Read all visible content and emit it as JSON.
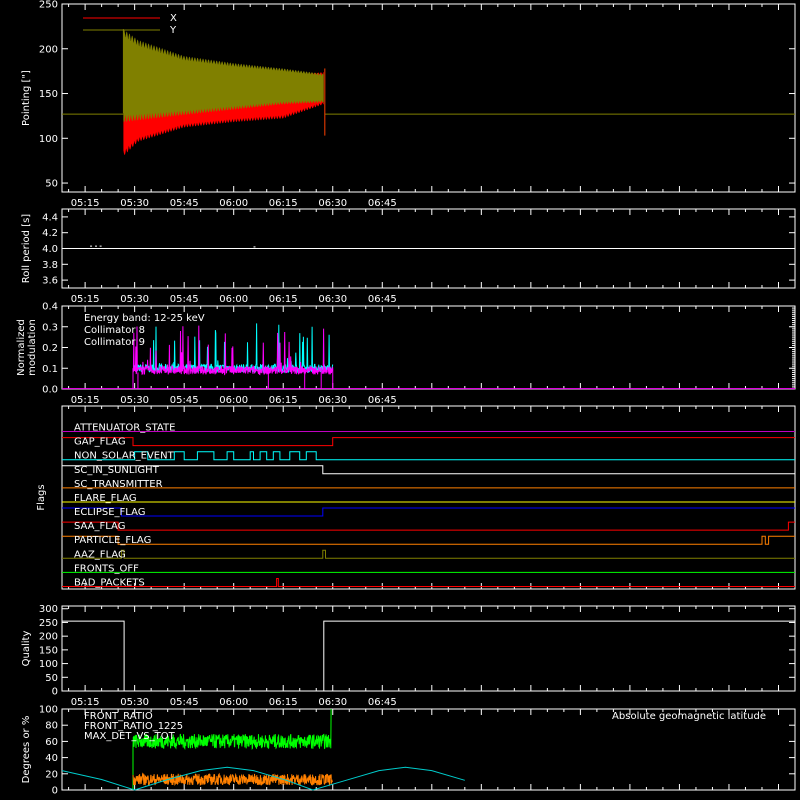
{
  "figure": {
    "background": "#000000",
    "foreground": "#ffffff",
    "time_ticks": [
      "05:15",
      "05:30",
      "05:45",
      "06:00",
      "06:15",
      "06:30",
      "06:45"
    ],
    "time_range_minutes": [
      308,
      530
    ],
    "x_tick_minutes": [
      315,
      330,
      345,
      360,
      375,
      390,
      405
    ]
  },
  "chart_data": [
    {
      "panel": "pointing",
      "type": "line",
      "ylabel": "Pointing [\"]",
      "ylim": [
        40,
        250
      ],
      "yticks": [
        50,
        100,
        150,
        200,
        250
      ],
      "legend_position": "top-left",
      "series": [
        {
          "name": "X",
          "color": "#ff0000",
          "baseline": 127,
          "envelope_start_min": 326.6,
          "envelope_end_min": 387.6,
          "envelope_upper": [
            [
              326.6,
              160
            ],
            [
              331,
              156
            ],
            [
              345,
              163
            ],
            [
              360,
              167
            ],
            [
              375,
              170
            ],
            [
              387.3,
              174
            ]
          ],
          "envelope_lower": [
            [
              326.6,
              80
            ],
            [
              331,
              96
            ],
            [
              345,
              112
            ],
            [
              360,
              118
            ],
            [
              375,
              122
            ],
            [
              387.3,
              138
            ]
          ]
        },
        {
          "name": "Y",
          "color": "#808000",
          "baseline": 127,
          "envelope_start_min": 326.6,
          "envelope_end_min": 387.6,
          "envelope_upper": [
            [
              326.6,
              222
            ],
            [
              331,
              210
            ],
            [
              345,
              192
            ],
            [
              360,
              184
            ],
            [
              375,
              178
            ],
            [
              387.3,
              172
            ]
          ],
          "envelope_lower": [
            [
              326.6,
              118
            ],
            [
              331,
              120
            ],
            [
              345,
              126
            ],
            [
              360,
              132
            ],
            [
              375,
              138
            ],
            [
              387.3,
              140
            ]
          ]
        }
      ]
    },
    {
      "panel": "roll_period",
      "type": "line",
      "ylabel": "Roll period [s]",
      "ylim": [
        3.5,
        4.5
      ],
      "yticks": [
        3.6,
        3.8,
        4.0,
        4.2,
        4.4
      ],
      "series": [
        {
          "name": "",
          "color": "#ffffff",
          "value": 4.0
        }
      ]
    },
    {
      "panel": "modulation",
      "type": "line",
      "ylabel": [
        "Normalized",
        "modulation"
      ],
      "ylim": [
        0,
        0.4
      ],
      "yticks": [
        0.0,
        0.1,
        0.2,
        0.3,
        0.4
      ],
      "annotation": "Energy band: 12-25 keV",
      "active_range_min": [
        329.5,
        390
      ],
      "series": [
        {
          "name": "Collimator 8",
          "color": "#00ffff",
          "level": 0.1
        },
        {
          "name": "Collimator 9",
          "color": "#ff00ff",
          "level": 0.09
        }
      ]
    },
    {
      "panel": "flags",
      "type": "line",
      "ylabel": "Flags",
      "series": [
        {
          "name": "ATTENUATOR_STATE",
          "color": "#c000c0",
          "segments": [
            [
              308,
              530,
              0
            ]
          ]
        },
        {
          "name": "GAP_FLAG",
          "color": "#ff0000",
          "segments": [
            [
              308,
              329.5,
              1
            ],
            [
              329.5,
              390,
              0
            ],
            [
              390,
              530,
              1
            ]
          ]
        },
        {
          "name": "NON_SOLAR_EVENT",
          "color": "#00ffff",
          "segments": [
            [
              308,
              330,
              0
            ],
            [
              330,
              334,
              1
            ],
            [
              334,
              342,
              0
            ],
            [
              342,
              345,
              1
            ],
            [
              345,
              349,
              0
            ],
            [
              349,
              354,
              1
            ],
            [
              354,
              358,
              0
            ],
            [
              358,
              360,
              1
            ],
            [
              360,
              365,
              0
            ],
            [
              365,
              366,
              1
            ],
            [
              366,
              368,
              0
            ],
            [
              368,
              370,
              1
            ],
            [
              370,
              372,
              0
            ],
            [
              372,
              374,
              1
            ],
            [
              374,
              377,
              0
            ],
            [
              377,
              380,
              1
            ],
            [
              380,
              382,
              0
            ],
            [
              382,
              385,
              1
            ],
            [
              385,
              530,
              0
            ]
          ]
        },
        {
          "name": "SC_IN_SUNLIGHT",
          "color": "#ffffff",
          "segments": [
            [
              308,
              387,
              1
            ],
            [
              387,
              530,
              0
            ]
          ]
        },
        {
          "name": "SC_TRANSMITTER",
          "color": "#ff8000",
          "segments": [
            [
              308,
              530,
              0
            ]
          ]
        },
        {
          "name": "FLARE_FLAG",
          "color": "#ffff00",
          "segments": [
            [
              308,
              530,
              0
            ]
          ]
        },
        {
          "name": "ECLIPSE_FLAG",
          "color": "#0000ff",
          "segments": [
            [
              308,
              326,
              1
            ],
            [
              326,
              387,
              0
            ],
            [
              387,
              530,
              1
            ]
          ]
        },
        {
          "name": "SAA_FLAG",
          "color": "#ff0000",
          "segments": [
            [
              308,
              325,
              1
            ],
            [
              325,
              528,
              0
            ],
            [
              528,
              530,
              1
            ]
          ]
        },
        {
          "name": "PARTICLE_FLAG",
          "color": "#ff8000",
          "segments": [
            [
              308,
              325,
              1
            ],
            [
              325,
              520,
              0
            ],
            [
              520,
              521,
              1
            ],
            [
              521,
              522,
              0
            ],
            [
              522,
              530,
              1
            ]
          ]
        },
        {
          "name": "AAZ_FLAG",
          "color": "#808000",
          "segments": [
            [
              308,
              326,
              0
            ],
            [
              326,
              326.8,
              1
            ],
            [
              326.8,
              387,
              0
            ],
            [
              387,
              387.8,
              1
            ],
            [
              387.8,
              530,
              0
            ]
          ]
        },
        {
          "name": "FRONTS_OFF",
          "color": "#00ff00",
          "segments": [
            [
              308,
              530,
              0
            ]
          ]
        },
        {
          "name": "BAD_PACKETS",
          "color": "#ff0000",
          "segments": [
            [
              308,
              373,
              0
            ],
            [
              373,
              373.5,
              1
            ],
            [
              373.5,
              530,
              0
            ]
          ]
        }
      ]
    },
    {
      "panel": "quality",
      "type": "line",
      "ylabel": "Quality",
      "ylim": [
        0,
        310
      ],
      "yticks": [
        0,
        50,
        100,
        150,
        200,
        250,
        300
      ],
      "series": [
        {
          "name": "",
          "color": "#ffffff",
          "segments": [
            [
              308,
              326.8,
              255
            ],
            [
              326.8,
              387.3,
              0
            ],
            [
              387.3,
              530,
              255
            ]
          ]
        }
      ]
    },
    {
      "panel": "geomagnetic",
      "type": "line",
      "ylabel": "Degrees or %",
      "ylim": [
        0,
        100
      ],
      "yticks": [
        0,
        20,
        40,
        60,
        80,
        100
      ],
      "series": [
        {
          "name": "FRONT_RATIO",
          "color": "#ffff00",
          "segments": []
        },
        {
          "name": "FRONT_RATIO_1225",
          "color": "#00ff00",
          "active_range_min": [
            329.5,
            390
          ],
          "level": 60
        },
        {
          "name": "MAX_DET_VS_TOT",
          "color": "#ff8000",
          "active_range_min": [
            329.5,
            390
          ],
          "level": 13
        },
        {
          "name": "Absolute geomagnetic latitude",
          "color": "#00cccc",
          "points": [
            [
              308,
              24
            ],
            [
              320,
              13
            ],
            [
              330,
              0
            ],
            [
              340,
              13
            ],
            [
              350,
              24
            ],
            [
              358,
              28
            ],
            [
              366,
              24
            ],
            [
              376,
              12
            ],
            [
              384,
              0
            ],
            [
              394,
              12
            ],
            [
              404,
              24
            ],
            [
              412,
              28
            ],
            [
              420,
              24
            ],
            [
              430,
              12
            ]
          ]
        }
      ]
    }
  ]
}
